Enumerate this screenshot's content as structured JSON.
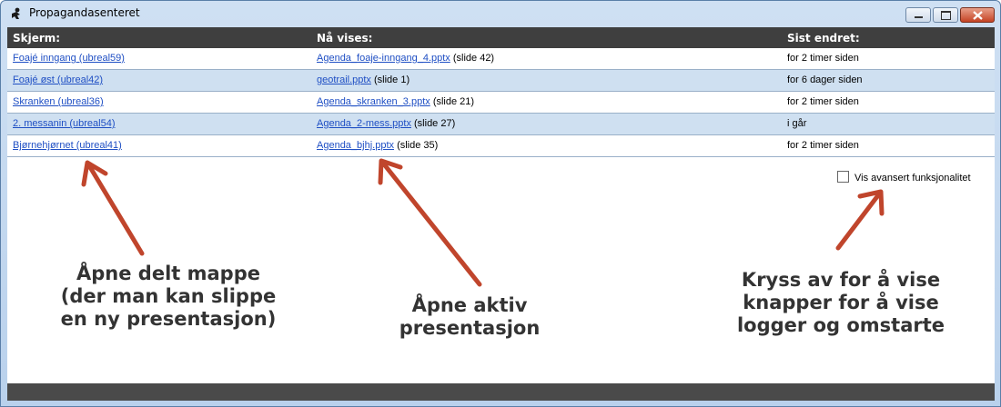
{
  "window": {
    "title": "Propagandasenteret",
    "app_icon": "sprinter-icon"
  },
  "table": {
    "headers": [
      "Skjerm:",
      "Nå vises:",
      "Sist endret:"
    ],
    "rows": [
      {
        "screen": "Foajé inngang (ubreal59)",
        "file": "Agenda_foaje-inngang_4.pptx",
        "slide": "(slide 42)",
        "changed": "for 2 timer siden"
      },
      {
        "screen": "Foajé øst (ubreal42)",
        "file": "geotrail.pptx",
        "slide": "(slide 1)",
        "changed": "for 6 dager siden"
      },
      {
        "screen": "Skranken (ubreal36)",
        "file": "Agenda_skranken_3.pptx",
        "slide": "(slide 21)",
        "changed": "for 2 timer siden"
      },
      {
        "screen": "2. messanin (ubreal54)",
        "file": "Agenda_2-mess.pptx",
        "slide": "(slide 27)",
        "changed": "i går"
      },
      {
        "screen": "Bjørnehjørnet (ubreal41)",
        "file": "Agenda_bjhj.pptx",
        "slide": "(slide 35)",
        "changed": "for 2 timer siden"
      }
    ]
  },
  "advanced": {
    "label": "Vis avansert funksjonalitet",
    "checked": false
  },
  "annotations": [
    {
      "lines": [
        "Åpne delt mappe",
        "(der man kan slippe",
        "en ny presentasjon)"
      ]
    },
    {
      "lines": [
        "Åpne aktiv",
        "presentasjon"
      ]
    },
    {
      "lines": [
        "Kryss av for å vise",
        "knapper for å vise",
        "logger og omstarte"
      ]
    }
  ],
  "colors": {
    "header_bg": "#3f3f3f",
    "row_alt_bg": "#cfe0f1",
    "link": "#1f4fc4",
    "arrow": "#c0452c"
  }
}
